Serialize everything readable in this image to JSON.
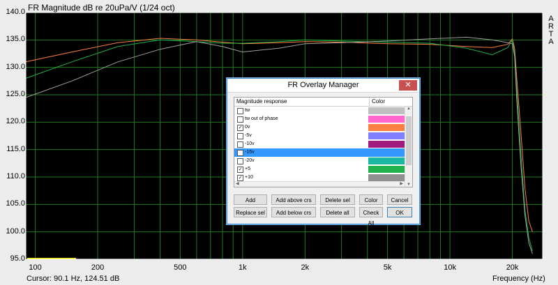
{
  "graph": {
    "title": "FR Magnitude dB re 20uPa/V (1/24 oct)",
    "vendor_letters": [
      "A",
      "R",
      "T",
      "A"
    ],
    "y_ticks": [
      "140.0",
      "135.0",
      "130.0",
      "125.0",
      "120.0",
      "115.0",
      "110.0",
      "105.0",
      "100.0",
      "95.0"
    ],
    "x_ticks": [
      "100",
      "200",
      "500",
      "1k",
      "2k",
      "5k",
      "10k",
      "20k"
    ],
    "cursor_readout": "Cursor: 90.1 Hz, 124.51 dB",
    "x_axis_label": "Frequency (Hz)",
    "colors": {
      "background": "#000000",
      "grid": "#1f7a1f",
      "axis_frame": "#ffffff",
      "cursor_mark": "#e6e600"
    }
  },
  "chart_data": {
    "type": "line",
    "x_scale": "log",
    "xlim": [
      90,
      28000
    ],
    "ylim": [
      95,
      140
    ],
    "grid": true,
    "series": [
      {
        "color": "#ff8040",
        "x": [
          90,
          150,
          250,
          400,
          600,
          800,
          1000,
          1500,
          2000,
          3000,
          5000,
          8000,
          12000,
          16000,
          19000,
          20000,
          20500,
          21000,
          22000,
          23000,
          24000,
          25000
        ],
        "y": [
          131.0,
          132.8,
          134.5,
          135.3,
          135.0,
          134.6,
          134.3,
          134.5,
          134.7,
          134.6,
          134.3,
          134.2,
          133.8,
          133.6,
          134.2,
          135.2,
          133.5,
          128.0,
          118.0,
          108.0,
          102.0,
          100.0
        ]
      },
      {
        "color": "#22b04a",
        "x": [
          90,
          150,
          250,
          400,
          600,
          800,
          1000,
          1500,
          2000,
          3000,
          5000,
          8000,
          12000,
          16000,
          19000,
          20000,
          20500,
          21000,
          22000,
          23000,
          24000,
          25000
        ],
        "y": [
          128.0,
          131.0,
          133.8,
          135.0,
          134.7,
          134.4,
          134.4,
          134.7,
          135.0,
          134.8,
          134.6,
          134.4,
          133.5,
          132.3,
          133.6,
          135.0,
          132.5,
          126.0,
          114.0,
          104.0,
          99.0,
          96.5
        ]
      },
      {
        "color": "#a0a0a0",
        "x": [
          90,
          150,
          250,
          400,
          600,
          800,
          1000,
          1500,
          2000,
          3000,
          5000,
          8000,
          12000,
          16000,
          19000,
          20000,
          20500,
          21000,
          22000,
          23000,
          24000,
          25000
        ],
        "y": [
          124.5,
          127.5,
          131.0,
          133.3,
          134.7,
          133.8,
          132.8,
          133.5,
          134.3,
          134.5,
          134.8,
          135.2,
          135.5,
          135.0,
          134.5,
          134.3,
          132.0,
          124.0,
          112.0,
          103.0,
          98.0,
          96.0
        ]
      }
    ]
  },
  "dialog": {
    "title": "FR Overlay Manager",
    "close_glyph": "✕",
    "columns": [
      "Magnitude response",
      "Color"
    ],
    "rows": [
      {
        "label": "tw",
        "checked": false,
        "color": "#c0c0c0"
      },
      {
        "label": "tw out of phase",
        "checked": false,
        "color": "#ff66d0"
      },
      {
        "label": "0v",
        "checked": true,
        "color": "#ff8040"
      },
      {
        "label": "-5v",
        "checked": false,
        "color": "#8080ff"
      },
      {
        "label": "-10v",
        "checked": false,
        "color": "#a01a80"
      },
      {
        "label": "-15v",
        "checked": false,
        "color": "#3399ff",
        "selected": true
      },
      {
        "label": "-20v",
        "checked": false,
        "color": "#1ab8a0"
      },
      {
        "label": "+5",
        "checked": true,
        "color": "#22b04a"
      },
      {
        "label": "+10",
        "checked": true,
        "color": "#909090"
      }
    ],
    "buttons_row1": [
      "Add",
      "Add above crs",
      "Delete sel",
      "Color",
      "Cancel"
    ],
    "buttons_row2": [
      "Replace sel",
      "Add below crs",
      "Delete all",
      "Check All",
      "OK"
    ]
  }
}
